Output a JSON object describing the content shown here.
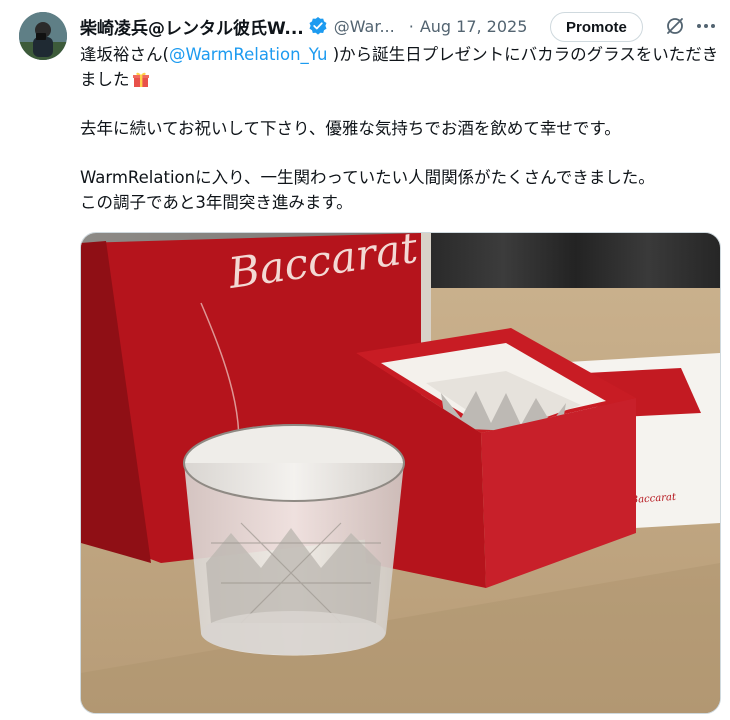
{
  "author": {
    "display_name": "柴崎凌兵@レンタル彼氏W...",
    "handle": "@War...",
    "separator": "·",
    "date": "Aug 17, 2025"
  },
  "actions": {
    "promote_label": "Promote"
  },
  "tweet": {
    "line1_pre": "逢坂裕さん(",
    "mention": "@WarmRelation_Yu",
    "line1_post": " )から誕生日プレゼントにバカラのグラスをいただきました",
    "para2": "去年に続いてお祝いして下さり、優雅な気持ちでお酒を飲めて幸せです。",
    "para3a": "WarmRelationに入り、一生関わっていたい人間関係がたくさんできました。",
    "para3b": "この調子であと3年間突き進みます。"
  },
  "media": {
    "bag_brand": "Baccarat",
    "card_brand": "Baccarat"
  },
  "colors": {
    "accent": "#1d9bf0",
    "text": "#0f1419",
    "muted": "#536471",
    "baccarat_red": "#b3121a"
  }
}
